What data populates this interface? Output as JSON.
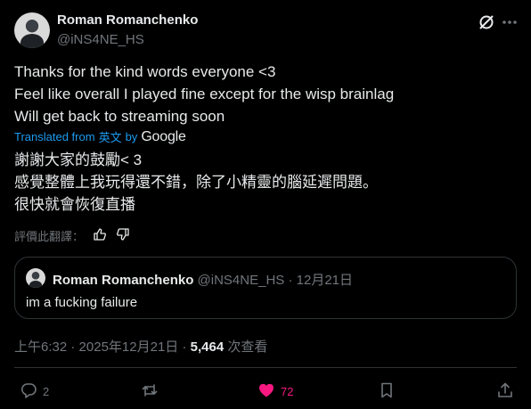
{
  "author": {
    "name": "Roman Romanchenko",
    "handle": "@iNS4NE_HS"
  },
  "tweet": {
    "lines": [
      "Thanks for the kind words everyone <3",
      "Feel like overall I played fine except for the wisp brainlag",
      "Will get back to streaming soon"
    ],
    "translated_prefix": "Translated from",
    "translated_lang": "英文",
    "translated_by": "by",
    "translated_brand": "Google",
    "translation_lines": [
      "謝謝大家的鼓勵< 3",
      "感覺整體上我玩得還不錯，除了小精靈的腦延遲問題。",
      "很快就會恢復直播"
    ],
    "rate_label": "評價此翻譯："
  },
  "quote": {
    "name": "Roman Romanchenko",
    "handle": "@iNS4NE_HS",
    "sep": "·",
    "date": "12月21日",
    "text": "im a fucking failure"
  },
  "meta": {
    "time": "上午6:32",
    "sep1": "·",
    "date": "2025年12月21日",
    "sep2": "·",
    "views": "5,464",
    "views_label": "次查看"
  },
  "actions": {
    "replies": "2",
    "reposts": "",
    "likes": "72",
    "like_color": "#f91880"
  },
  "icons": [
    "grok-icon",
    "more-icon",
    "thumbs-up-icon",
    "thumbs-down-icon",
    "reply-icon",
    "repost-icon",
    "heart-icon",
    "bookmark-icon",
    "share-icon"
  ]
}
